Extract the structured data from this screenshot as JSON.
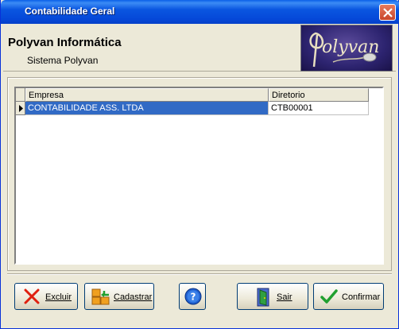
{
  "window": {
    "title": "Contabilidade Geral"
  },
  "header": {
    "company": "Polyvan Informática",
    "system": "Sistema Polyvan",
    "logo_text": "Polyvan"
  },
  "grid": {
    "columns": [
      "Empresa",
      "Diretorio"
    ],
    "rows": [
      {
        "empresa": "CONTABILIDADE ASS. LTDA",
        "diretorio": "CTB00001",
        "selected": true
      }
    ]
  },
  "buttons": {
    "excluir": "Excluir",
    "cadastrar": "Cadastrar",
    "sair": "Sair",
    "confirmar": "Confirmar"
  },
  "colors": {
    "titlebar": "#0548d8",
    "selection": "#316ac5",
    "face": "#ece9d8"
  }
}
